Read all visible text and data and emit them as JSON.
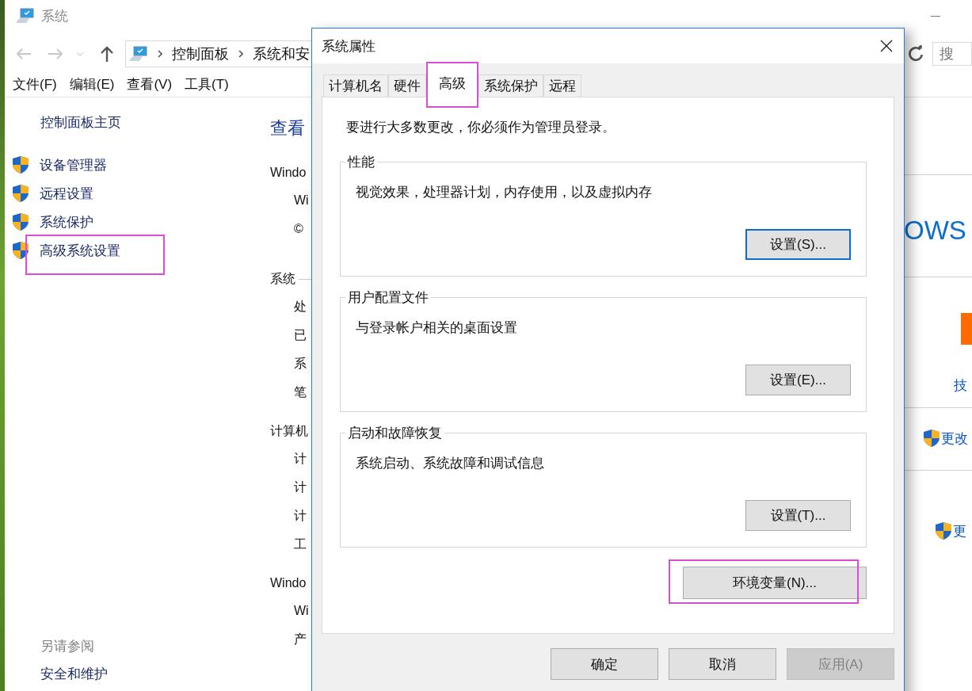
{
  "window": {
    "title": "系统"
  },
  "nav": {
    "breadcrumbs": [
      "控制面板",
      "系统和安"
    ],
    "search": {
      "placeholder": "搜"
    }
  },
  "menu": [
    "文件(F)",
    "编辑(E)",
    "查看(V)",
    "工具(T)"
  ],
  "sidebar": {
    "home": "控制面板主页",
    "items": [
      {
        "label": "设备管理器",
        "highlighted": false
      },
      {
        "label": "远程设置",
        "highlighted": false
      },
      {
        "label": "系统保护",
        "highlighted": false
      },
      {
        "label": "高级系统设置",
        "highlighted": true
      }
    ],
    "see_also": {
      "heading": "另请参阅",
      "items": [
        "安全和维护"
      ]
    }
  },
  "content": {
    "heading": "查看",
    "lines": [
      {
        "kind": "section",
        "text": "Windo"
      },
      {
        "kind": "item",
        "text": "Wi"
      },
      {
        "kind": "item",
        "text": "©"
      },
      {
        "kind": "rule",
        "text": "系统"
      },
      {
        "kind": "item",
        "text": "处"
      },
      {
        "kind": "item",
        "text": "已"
      },
      {
        "kind": "item",
        "text": "系"
      },
      {
        "kind": "item",
        "text": "笔"
      },
      {
        "kind": "section",
        "text": "计算机"
      },
      {
        "kind": "item",
        "text": "计"
      },
      {
        "kind": "item",
        "text": "计"
      },
      {
        "kind": "item",
        "text": "计"
      },
      {
        "kind": "item",
        "text": "工"
      },
      {
        "kind": "section",
        "text": "Windo"
      },
      {
        "kind": "item",
        "text": "Wi"
      },
      {
        "kind": "item",
        "text": "产"
      }
    ]
  },
  "right": {
    "brand": "OWS",
    "link": "技",
    "change_link": "更改",
    "bottom_link": "更"
  },
  "dialog": {
    "title": "系统属性",
    "tabs": [
      {
        "label": "计算机名",
        "selected": false,
        "highlighted": false
      },
      {
        "label": "硬件",
        "selected": false,
        "highlighted": false
      },
      {
        "label": "高级",
        "selected": true,
        "highlighted": true
      },
      {
        "label": "系统保护",
        "selected": false,
        "highlighted": false
      },
      {
        "label": "远程",
        "selected": false,
        "highlighted": false
      }
    ],
    "notice": "要进行大多数更改，你必须作为管理员登录。",
    "groups": [
      {
        "title": "性能",
        "description": "视觉效果，处理器计划，内存使用，以及虚拟内存",
        "button": "设置(S)...",
        "focused": true
      },
      {
        "title": "用户配置文件",
        "description": "与登录帐户相关的桌面设置",
        "button": "设置(E)...",
        "focused": false
      },
      {
        "title": "启动和故障恢复",
        "description": "系统启动、系统故障和调试信息",
        "button": "设置(T)...",
        "focused": false
      }
    ],
    "env_button": {
      "label": "环境变量(N)...",
      "highlighted": true
    },
    "buttons": [
      {
        "label": "确定",
        "disabled": false
      },
      {
        "label": "取消",
        "disabled": false
      },
      {
        "label": "应用(A)",
        "disabled": true
      }
    ]
  }
}
